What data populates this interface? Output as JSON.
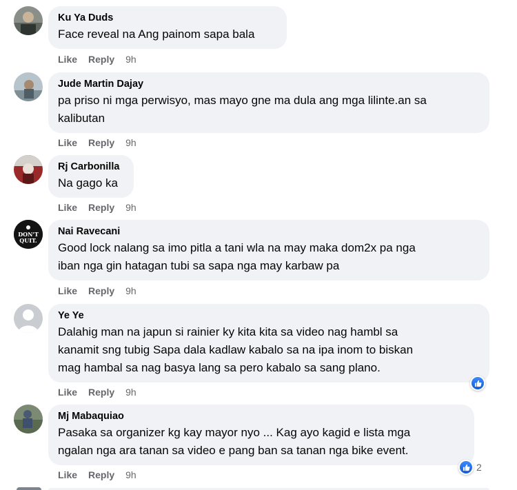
{
  "actions": {
    "like": "Like",
    "reply": "Reply"
  },
  "comments": [
    {
      "name": "Ku Ya Duds",
      "lines": [
        "Face reveal na Ang painom sapa bala"
      ],
      "time": "9h"
    },
    {
      "name": "Jude Martin Dajay",
      "lines": [
        "pa priso ni mga perwisyo, mas mayo gne ma dula ang mga lilinte.an sa",
        "kalibutan"
      ],
      "time": "9h"
    },
    {
      "name": "Rj Carbonilla",
      "lines": [
        "Na gago ka"
      ],
      "time": "9h"
    },
    {
      "name": "Nai Ravecani",
      "lines": [
        "Good lock nalang sa imo pitla a tani wla na may maka dom2x pa nga",
        "iban nga gin hatagan tubi sa sapa nga may karbaw pa"
      ],
      "time": "9h",
      "avatar_text": "DON'T QUIT."
    },
    {
      "name": "Ye Ye",
      "lines": [
        "Dalahig man na japun si rainier ky kita kita sa video nag hambl sa",
        "kanamit sng tubig Sapa dala kadlaw kabalo sa na ipa inom to biskan",
        "mag hambal sa nag basya lang sa pero kabalo sa sang plano."
      ],
      "time": "9h",
      "reaction": {
        "icon": "like-icon",
        "count": ""
      }
    },
    {
      "name": "Mj Mabaquiao",
      "lines": [
        "Pasaka sa organizer kg kay mayor nyo ... Kag ayo kagid e lista mga",
        "ngalan nga ara tanan sa video e pang ban sa tanan nga bike event."
      ],
      "time": "9h",
      "reaction": {
        "icon": "like-icon",
        "count": "2"
      }
    }
  ],
  "colors": {
    "bubble": "#f0f2f5",
    "meta": "#65676b",
    "text": "#050505",
    "like_blue": "#1877f2"
  }
}
